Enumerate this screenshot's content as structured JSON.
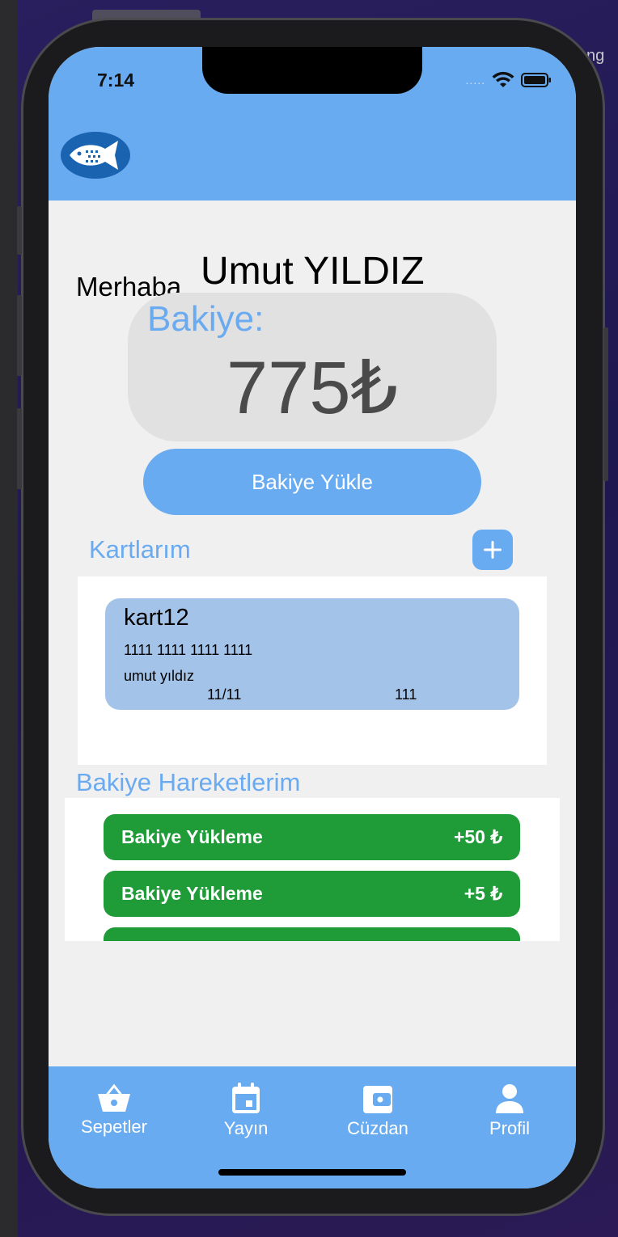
{
  "status": {
    "time": "7:14",
    "signal_dots": "....."
  },
  "greeting": {
    "label": "Merhaba,",
    "name": "Umut YILDIZ"
  },
  "balance": {
    "label": "Bakiye:",
    "value": "775₺"
  },
  "topup_button": "Bakiye Yükle",
  "cards_section": {
    "title": "Kartlarım",
    "cards": [
      {
        "name": "kart12",
        "number": "1111 1111 1111 1111",
        "holder": "umut yıldız",
        "expiry": "11/11",
        "cvv": "111"
      }
    ]
  },
  "transactions_section": {
    "title": "Bakiye Hareketlerim",
    "items": [
      {
        "label": "Bakiye Yükleme",
        "amount": "+50 ₺"
      },
      {
        "label": "Bakiye Yükleme",
        "amount": "+5 ₺"
      },
      {
        "label": "",
        "amount": ""
      }
    ]
  },
  "tabbar": {
    "items": [
      {
        "label": "Sepetler",
        "icon": "basket-icon"
      },
      {
        "label": "Yayın",
        "icon": "calendar-icon"
      },
      {
        "label": "Cüzdan",
        "icon": "wallet-icon"
      },
      {
        "label": "Profil",
        "icon": "person-icon"
      }
    ]
  },
  "colors": {
    "accent": "#68abf1",
    "success": "#1f9c38",
    "card": "#a3c3e9",
    "background": "#f0f0f0"
  }
}
